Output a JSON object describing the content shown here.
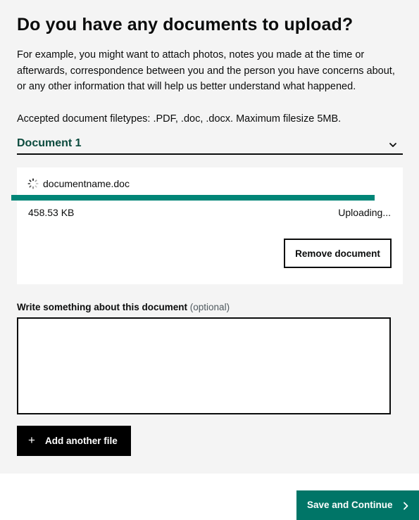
{
  "page": {
    "heading": "Do you have any documents to upload?",
    "intro": "For example, you might want to attach photos, notes you made at the time or afterwards, correspondence between you and the person you have concerns about, or any other information that will help us better understand what happened.",
    "filetypes": "Accepted document filetypes: .PDF, .doc, .docx. Maximum filesize 5MB."
  },
  "document": {
    "title": "Document 1",
    "icon": "chevron-down-icon",
    "file": {
      "name": "documentname.doc",
      "size": "458.53 KB",
      "status": "Uploading...",
      "progress_fraction": 1.0,
      "icon": "spinner-icon"
    },
    "remove_label": "Remove document"
  },
  "description": {
    "label": "Write something about this document",
    "optional": "(optional)",
    "value": ""
  },
  "actions": {
    "add_plus": "+",
    "add_label": "Add another file",
    "save_label": "Save and Continue",
    "save_icon": "chevron-right-icon"
  },
  "colors": {
    "brand_green": "#007567",
    "heading_green": "#0b4a3d",
    "progress": "#008577",
    "panel_bg": "#f4f4f4"
  }
}
